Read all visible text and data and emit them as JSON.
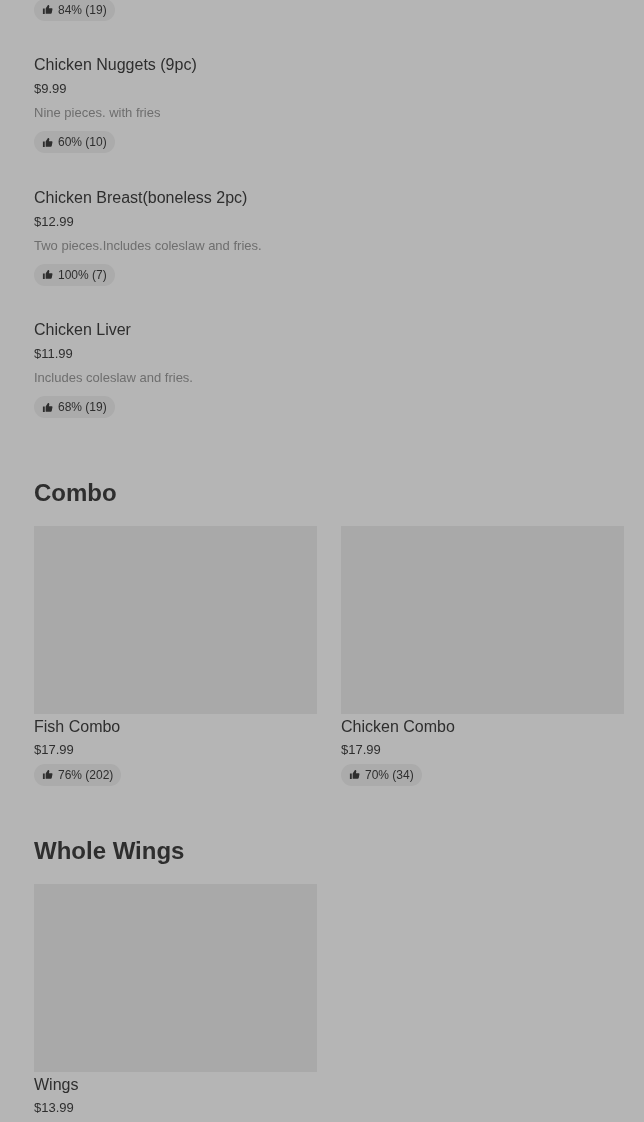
{
  "items": [
    {
      "rating": "84% (19)"
    },
    {
      "name": "Chicken Nuggets (9pc)",
      "price": "$9.99",
      "description": "Nine pieces. with fries",
      "rating": "60% (10)"
    },
    {
      "name": "Chicken Breast(boneless 2pc)",
      "price": "$12.99",
      "description": "Two pieces.Includes coleslaw and fries.",
      "rating": "100% (7)"
    },
    {
      "name": "Chicken Liver",
      "price": "$11.99",
      "description": "Includes coleslaw and fries.",
      "rating": "68% (19)"
    }
  ],
  "sections": [
    {
      "title": "Combo",
      "cards": [
        {
          "name": "Fish Combo",
          "price": "$17.99",
          "rating": "76% (202)"
        },
        {
          "name": "Chicken Combo",
          "price": "$17.99",
          "rating": "70% (34)"
        }
      ]
    },
    {
      "title": "Whole Wings",
      "cards": [
        {
          "name": "Wings",
          "price": "$13.99",
          "rating_badge_cut": true
        }
      ]
    }
  ]
}
